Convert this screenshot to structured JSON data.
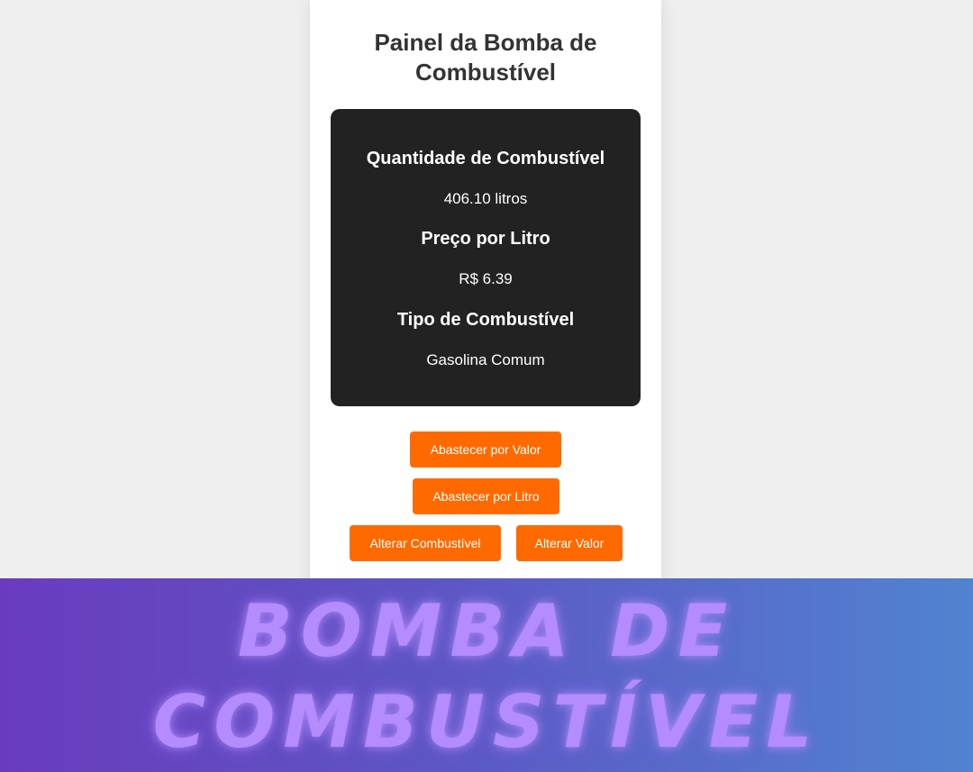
{
  "panel": {
    "title": "Painel da Bomba de Combustível"
  },
  "display": {
    "quantity_label": "Quantidade de Combustível",
    "quantity_value": "406.10 litros",
    "price_label": "Preço por Litro",
    "price_value": "R$ 6.39",
    "fuel_type_label": "Tipo de Combustível",
    "fuel_type_value": "Gasolina Comum"
  },
  "buttons": {
    "fill_by_value": "Abastecer por Valor",
    "fill_by_liter": "Abastecer por Litro",
    "change_fuel": "Alterar Combustível",
    "change_price": "Alterar Valor"
  },
  "banner": {
    "line1": "BOMBA DE",
    "line2": "COMBUSTÍVEL"
  },
  "colors": {
    "page_background": "#efefef",
    "panel_background": "#ffffff",
    "display_background": "#222222",
    "button_accent": "#ff6a00",
    "banner_gradient_start": "#6a3bbf",
    "banner_gradient_end": "#5183d1",
    "banner_text": "#b48cff"
  }
}
